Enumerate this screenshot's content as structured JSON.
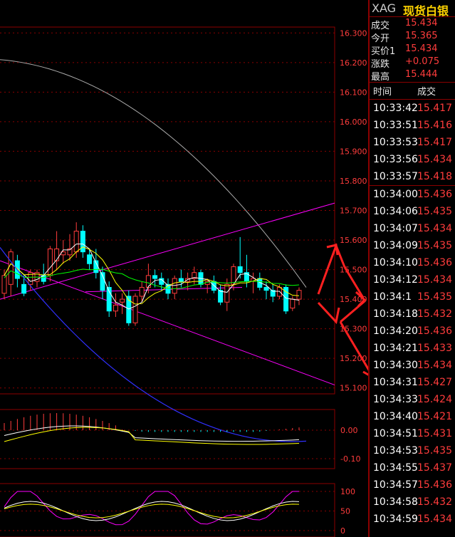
{
  "quote": {
    "symbol": "XAG",
    "name": "现货白银",
    "rows": [
      {
        "label": "成交",
        "value": "15.434"
      },
      {
        "label": "今开",
        "value": "15.365"
      },
      {
        "label": "买价1",
        "value": "15.434"
      },
      {
        "label": "涨跌",
        "value": "+0.075"
      },
      {
        "label": "最高",
        "value": "15.444"
      }
    ]
  },
  "ticks": {
    "header_time": "时间",
    "header_price": "成交",
    "rows": [
      {
        "time": "10:33:42",
        "price": "15.417"
      },
      {
        "time": "10:33:51",
        "price": "15.416"
      },
      {
        "time": "10:33:53",
        "price": "15.417"
      },
      {
        "time": "10:33:56",
        "price": "15.434"
      },
      {
        "time": "10:33:57",
        "price": "15.418"
      },
      {
        "time": "10:34:00",
        "price": "15.436"
      },
      {
        "time": "10:34:06",
        "price": "15.435"
      },
      {
        "time": "10:34:07",
        "price": "15.434"
      },
      {
        "time": "10:34:09",
        "price": "15.435"
      },
      {
        "time": "10:34:10",
        "price": "15.436"
      },
      {
        "time": "10:34:12",
        "price": "15.434"
      },
      {
        "time": "10:34:1",
        "price": "15.435"
      },
      {
        "time": "10:34:18",
        "price": "15.432"
      },
      {
        "time": "10:34:20",
        "price": "15.436"
      },
      {
        "time": "10:34:21",
        "price": "15.433"
      },
      {
        "time": "10:34:30",
        "price": "15.434"
      },
      {
        "time": "10:34:31",
        "price": "15.427"
      },
      {
        "time": "10:34:33",
        "price": "15.424"
      },
      {
        "time": "10:34:40",
        "price": "15.421"
      },
      {
        "time": "10:34:51",
        "price": "15.431"
      },
      {
        "time": "10:34:53",
        "price": "15.435"
      },
      {
        "time": "10:34:55",
        "price": "15.437"
      },
      {
        "time": "10:34:57",
        "price": "15.436"
      },
      {
        "time": "10:34:58",
        "price": "15.432"
      },
      {
        "time": "10:34:59",
        "price": "15.434"
      }
    ]
  },
  "chart_data": [
    {
      "type": "candlestick",
      "panel": "price",
      "ylim": [
        15.08,
        16.32
      ],
      "yticks": [
        "16.300",
        "16.200",
        "16.100",
        "16.000",
        "15.900",
        "15.800",
        "15.700",
        "15.600",
        "15.500",
        "15.400",
        "15.300",
        "15.200",
        "15.100"
      ],
      "candles": [
        {
          "o": 15.42,
          "h": 15.5,
          "l": 15.4,
          "c": 15.48
        },
        {
          "o": 15.45,
          "h": 15.57,
          "l": 15.41,
          "c": 15.56
        },
        {
          "o": 15.53,
          "h": 15.55,
          "l": 15.44,
          "c": 15.47
        },
        {
          "o": 15.45,
          "h": 15.48,
          "l": 15.41,
          "c": 15.42
        },
        {
          "o": 15.45,
          "h": 15.5,
          "l": 15.43,
          "c": 15.49
        },
        {
          "o": 15.46,
          "h": 15.5,
          "l": 15.44,
          "c": 15.49
        },
        {
          "o": 15.48,
          "h": 15.52,
          "l": 15.45,
          "c": 15.46
        },
        {
          "o": 15.48,
          "h": 15.58,
          "l": 15.46,
          "c": 15.57
        },
        {
          "o": 15.53,
          "h": 15.63,
          "l": 15.5,
          "c": 15.57
        },
        {
          "o": 15.55,
          "h": 15.6,
          "l": 15.52,
          "c": 15.56
        },
        {
          "o": 15.55,
          "h": 15.62,
          "l": 15.53,
          "c": 15.57
        },
        {
          "o": 15.56,
          "h": 15.66,
          "l": 15.54,
          "c": 15.63
        },
        {
          "o": 15.63,
          "h": 15.65,
          "l": 15.54,
          "c": 15.56
        },
        {
          "o": 15.55,
          "h": 15.57,
          "l": 15.5,
          "c": 15.52
        },
        {
          "o": 15.53,
          "h": 15.57,
          "l": 15.47,
          "c": 15.49
        },
        {
          "o": 15.49,
          "h": 15.51,
          "l": 15.4,
          "c": 15.43
        },
        {
          "o": 15.44,
          "h": 15.46,
          "l": 15.34,
          "c": 15.36
        },
        {
          "o": 15.36,
          "h": 15.42,
          "l": 15.34,
          "c": 15.38
        },
        {
          "o": 15.39,
          "h": 15.42,
          "l": 15.35,
          "c": 15.4
        },
        {
          "o": 15.41,
          "h": 15.43,
          "l": 15.31,
          "c": 15.32
        },
        {
          "o": 15.32,
          "h": 15.42,
          "l": 15.31,
          "c": 15.41
        },
        {
          "o": 15.41,
          "h": 15.46,
          "l": 15.39,
          "c": 15.44
        },
        {
          "o": 15.44,
          "h": 15.52,
          "l": 15.42,
          "c": 15.48
        },
        {
          "o": 15.48,
          "h": 15.5,
          "l": 15.44,
          "c": 15.47
        },
        {
          "o": 15.47,
          "h": 15.49,
          "l": 15.43,
          "c": 15.45
        },
        {
          "o": 15.45,
          "h": 15.47,
          "l": 15.4,
          "c": 15.42
        },
        {
          "o": 15.42,
          "h": 15.48,
          "l": 15.4,
          "c": 15.47
        },
        {
          "o": 15.47,
          "h": 15.5,
          "l": 15.44,
          "c": 15.46
        },
        {
          "o": 15.46,
          "h": 15.49,
          "l": 15.43,
          "c": 15.47
        },
        {
          "o": 15.47,
          "h": 15.51,
          "l": 15.45,
          "c": 15.49
        },
        {
          "o": 15.49,
          "h": 15.5,
          "l": 15.44,
          "c": 15.45
        },
        {
          "o": 15.45,
          "h": 15.47,
          "l": 15.42,
          "c": 15.46
        },
        {
          "o": 15.46,
          "h": 15.48,
          "l": 15.42,
          "c": 15.43
        },
        {
          "o": 15.43,
          "h": 15.45,
          "l": 15.38,
          "c": 15.39
        },
        {
          "o": 15.39,
          "h": 15.47,
          "l": 15.36,
          "c": 15.45
        },
        {
          "o": 15.45,
          "h": 15.52,
          "l": 15.43,
          "c": 15.51
        },
        {
          "o": 15.51,
          "h": 15.61,
          "l": 15.47,
          "c": 15.49
        },
        {
          "o": 15.49,
          "h": 15.55,
          "l": 15.44,
          "c": 15.46
        },
        {
          "o": 15.46,
          "h": 15.49,
          "l": 15.42,
          "c": 15.47
        },
        {
          "o": 15.47,
          "h": 15.49,
          "l": 15.43,
          "c": 15.44
        },
        {
          "o": 15.44,
          "h": 15.46,
          "l": 15.4,
          "c": 15.43
        },
        {
          "o": 15.43,
          "h": 15.45,
          "l": 15.39,
          "c": 15.41
        },
        {
          "o": 15.41,
          "h": 15.45,
          "l": 15.4,
          "c": 15.44
        },
        {
          "o": 15.44,
          "h": 15.45,
          "l": 15.35,
          "c": 15.36
        },
        {
          "o": 15.37,
          "h": 15.41,
          "l": 15.36,
          "c": 15.4
        },
        {
          "o": 15.4,
          "h": 15.44,
          "l": 15.38,
          "c": 15.43
        }
      ]
    },
    {
      "type": "bar",
      "panel": "macd",
      "ylim": [
        -0.14,
        0.07
      ],
      "yticks": [
        "0.00",
        "-0.10"
      ]
    },
    {
      "type": "line",
      "panel": "oscillator",
      "ylim": [
        0,
        110
      ],
      "yticks": [
        "100",
        "50",
        "0"
      ]
    }
  ],
  "colors": {
    "up": "#ff3c3c",
    "down": "#00ffff",
    "grid": "#8b0000",
    "ma_white": "#ffffff",
    "ma_yellow": "#ffff00",
    "ma_green": "#00ff00",
    "ma_blue": "#3030ff",
    "trend": "#ff00ff",
    "arrow": "#ff2020"
  }
}
